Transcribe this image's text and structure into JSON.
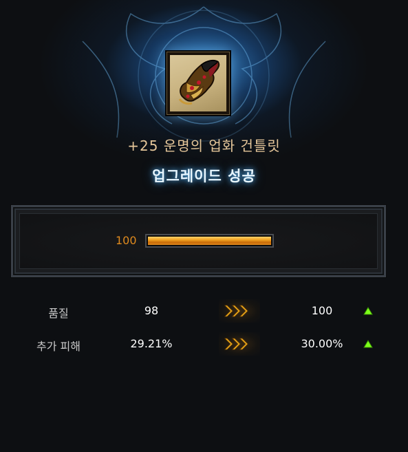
{
  "item": {
    "icon": "gauntlet-icon",
    "name": "+25 운명의 업화 건틀릿"
  },
  "result": {
    "label": "업그레이드 성공"
  },
  "progress": {
    "value_text": "100",
    "fraction": 1.0,
    "color": "#e08a1e"
  },
  "stats": [
    {
      "name": "품질",
      "before": "98",
      "after": "100",
      "change_icon": "arrow-up-icon"
    },
    {
      "name": "추가 피해",
      "before": "29.21%",
      "after": "30.00%",
      "change_icon": "arrow-up-icon"
    }
  ],
  "colors": {
    "accent_blue_glow": "#5abeff",
    "title_gold": "#e6c79a",
    "increase_green": "#7dff1a"
  }
}
